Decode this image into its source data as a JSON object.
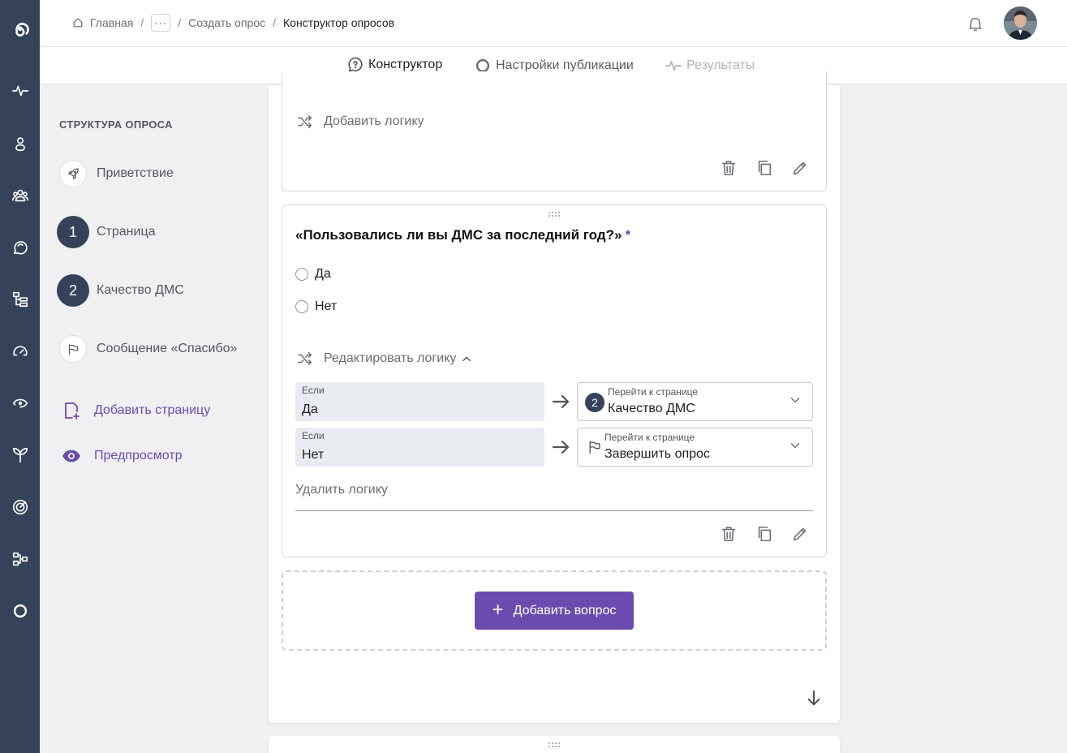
{
  "colors": {
    "accent": "#6b4cae",
    "rail": "#34435a",
    "badge": "#34435a"
  },
  "rail": {
    "icons": [
      "logo-spiral-icon",
      "pulse-icon",
      "person-icon",
      "group-icon",
      "chat-refresh-icon",
      "hierarchy-icon",
      "speedometer-icon",
      "eye-orbit-icon",
      "sprout-icon",
      "target-icon",
      "flow-icon",
      "settings-icon"
    ]
  },
  "breadcrumbs": {
    "home": "Главная",
    "more": "···",
    "create": "Создать опрос",
    "current": "Конструктор опросов"
  },
  "tabs": {
    "constructor": "Конструктор",
    "publish": "Настройки публикации",
    "results": "Результаты"
  },
  "structure": {
    "title": "СТРУКТУРА ОПРОСА",
    "welcome": "Приветствие",
    "page1_num": "1",
    "page1_label": "Страница",
    "page2_num": "2",
    "page2_label": "Качество ДМС",
    "thanks": "Сообщение «Спасибо»",
    "add_page": "Добавить страницу",
    "preview": "Предпросмотр"
  },
  "card1": {
    "add_logic": "Добавить логику"
  },
  "card2": {
    "question": "«Пользовались ли вы ДМС за последний год?»",
    "required_mark": "*",
    "options": [
      "Да",
      "Нет"
    ],
    "edit_logic": "Редактировать логику",
    "rules": [
      {
        "if_label": "Если",
        "if_value": "Да",
        "goto_label": "Перейти к странице",
        "goto_badge": "2",
        "goto_value": "Качество ДМС"
      },
      {
        "if_label": "Если",
        "if_value": "Нет",
        "goto_label": "Перейти к странице",
        "goto_value": "Завершить опрос"
      }
    ],
    "delete_logic": "Удалить логику"
  },
  "add_question": "Добавить вопрос"
}
